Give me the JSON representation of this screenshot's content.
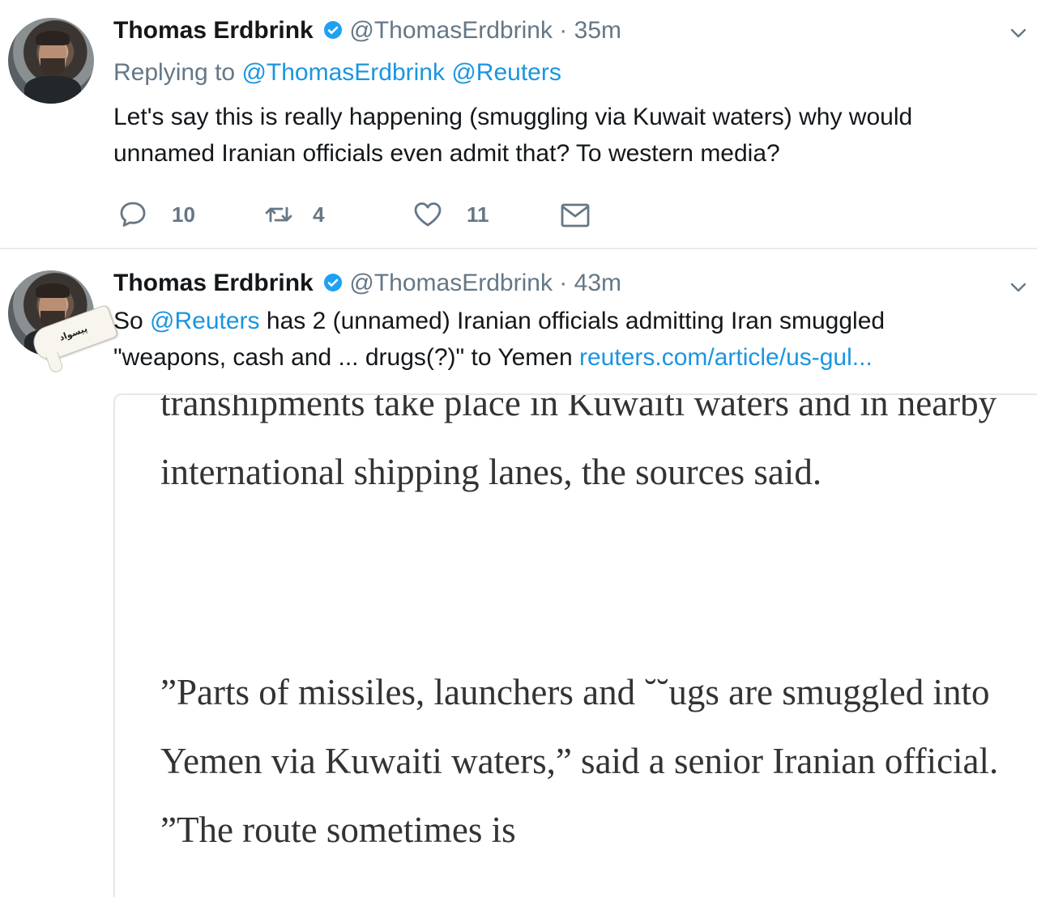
{
  "tweets": [
    {
      "author_name": "Thomas Erdbrink",
      "handle": "@ThomasErdbrink",
      "separator": "·",
      "time": "35m",
      "replying_prefix": "Replying to",
      "replying_handles": [
        "@ThomasErdbrink",
        "@Reuters"
      ],
      "text": "Let's say this is really happening (smuggling via Kuwait waters) why would unnamed Iranian officials even admit that? To western media?",
      "actions": {
        "reply_count": "10",
        "retweet_count": "4",
        "like_count": "11"
      }
    },
    {
      "author_name": "Thomas Erdbrink",
      "handle": "@ThomasErdbrink",
      "separator": "·",
      "time": "43m",
      "text_prefix": "So",
      "mention": "@Reuters",
      "text_middle": "has 2 (unnamed) Iranian officials admitting Iran smuggled \"weapons, cash and ... drugs(?)\" to Yemen",
      "link": "reuters.com/article/us-gul...",
      "article": {
        "paragraph1": "transhipments take place in Kuwaiti waters and in nearby international shipping lanes, the sources said.",
        "paragraph2": "”Parts of missiles, launchers and ˘˘ugs are smuggled into Yemen via Kuwaiti waters,” said a senior Iranian official. ”The route sometimes is"
      }
    }
  ],
  "watermark_text": "پیسواد",
  "icons": {
    "verified": "verified-badge-icon",
    "chevron": "chevron-down-icon",
    "reply": "reply-icon",
    "retweet": "retweet-icon",
    "like": "heart-icon",
    "dm": "envelope-icon"
  },
  "colors": {
    "link": "#1b95e0",
    "muted": "#657786",
    "text": "#14171a",
    "verified": "#1da1f2"
  }
}
